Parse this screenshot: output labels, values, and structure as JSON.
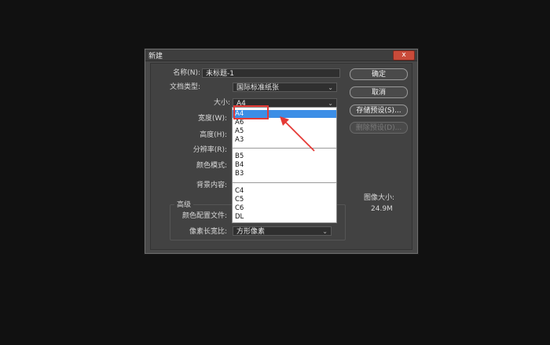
{
  "dialog": {
    "title": "新建",
    "close_label": "x"
  },
  "form": {
    "name_label": "名称(N):",
    "name_value": "未标题-1",
    "doc_type_label": "文档类型:",
    "doc_type_value": "国际标准纸张",
    "size_label": "大小:",
    "size_value": "A4",
    "width_label": "宽度(W):",
    "height_label": "高度(H):",
    "resolution_label": "分辨率(R):",
    "color_mode_label": "颜色模式:",
    "background_label": "背景内容:",
    "advanced_label": "高级",
    "color_profile_label": "颜色配置文件:",
    "pixel_aspect_label": "像素长宽比:",
    "pixel_aspect_value": "方形像素"
  },
  "buttons": {
    "ok": "确定",
    "cancel": "取消",
    "save_preset": "存储预设(S)...",
    "delete_preset": "删除预设(D)..."
  },
  "image_size": {
    "label": "图像大小:",
    "value": "24.9M"
  },
  "size_options": {
    "group_a": [
      "A4",
      "A6",
      "A5",
      "A3"
    ],
    "group_b": [
      "B5",
      "B4",
      "B3"
    ],
    "group_c": [
      "C4",
      "C5",
      "C6",
      "DL"
    ],
    "selected": "A4"
  },
  "colors": {
    "accent_selection": "#3c8ee6",
    "annotation_red": "#e53935"
  }
}
